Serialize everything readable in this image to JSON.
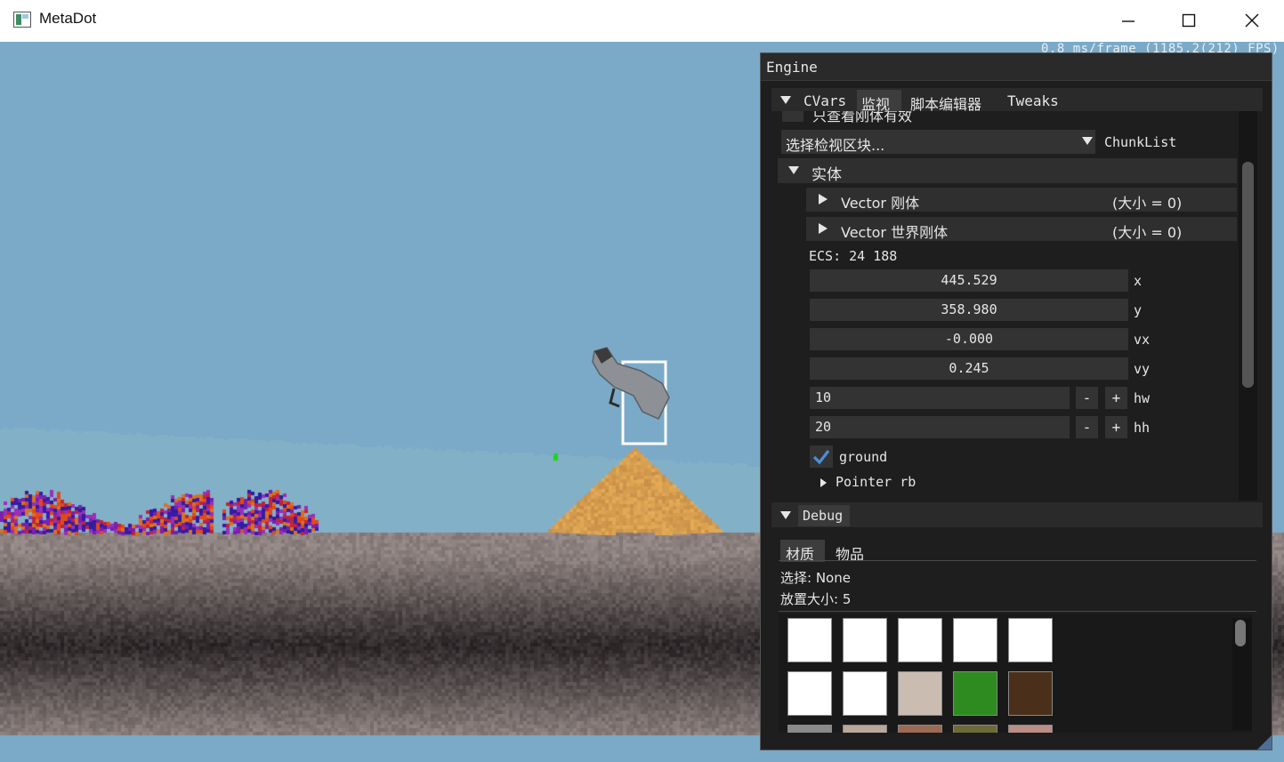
{
  "window": {
    "title": "MetaDot",
    "icons": {
      "app": "app-icon",
      "minimize": "minimize-icon",
      "maximize": "maximize-icon",
      "close": "close-icon"
    }
  },
  "viewport": {
    "fps_text": "0.8 ms/frame (1185.2(212) FPS)"
  },
  "engine": {
    "title": "Engine",
    "tabs": [
      {
        "label": "CVars"
      },
      {
        "label": "监视"
      },
      {
        "label": "脚本编辑器"
      },
      {
        "label": "Tweaks"
      }
    ],
    "watch": {
      "clipped_checkbox_label": "只查看刚体有效",
      "chunk_select_value": "选择检视区块...",
      "chunk_select_label": "ChunkList",
      "entity_header": "实体",
      "vectors": [
        {
          "label": "Vector 刚体",
          "size": "(大小 = 0)"
        },
        {
          "label": "Vector 世界刚体",
          "size": "(大小 = 0)"
        }
      ],
      "ecs_text": "ECS: 24 188",
      "floats": [
        {
          "value": "445.529",
          "label": "x"
        },
        {
          "value": "358.980",
          "label": "y"
        },
        {
          "value": "-0.000",
          "label": "vx"
        },
        {
          "value": "0.245",
          "label": "vy"
        }
      ],
      "ints": [
        {
          "value": "10",
          "label": "hw",
          "minus": "-",
          "plus": "+"
        },
        {
          "value": "20",
          "label": "hh",
          "minus": "-",
          "plus": "+"
        }
      ],
      "ground_label": "ground",
      "ground_checked": true,
      "pointer_label": "Pointer rb"
    },
    "debug": {
      "header": "Debug",
      "tabs": [
        {
          "label": "材质"
        },
        {
          "label": "物品"
        }
      ],
      "selected_text": "选择: None",
      "place_size_text": "放置大小: 5",
      "swatches": [
        [
          "#ffffff",
          "#ffffff",
          "#ffffff",
          "#ffffff",
          "#ffffff"
        ],
        [
          "#ffffff",
          "#ffffff",
          "#cbbcb1",
          "#2e8b1f",
          "#4a2f1a"
        ],
        [
          "#8a8a8a",
          "#b9a99a",
          "#9b6a55",
          "#6e6a3b",
          "#b98e86"
        ]
      ]
    },
    "colors": {
      "accent": "#4a8fd9",
      "panel_bg": "#1e1e1e"
    }
  }
}
